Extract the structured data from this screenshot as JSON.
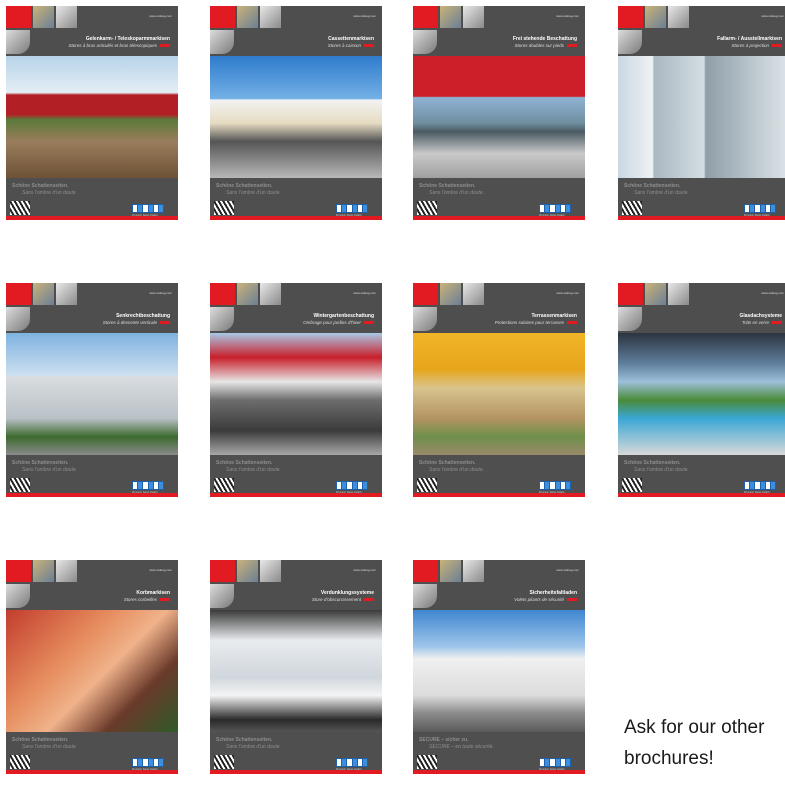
{
  "brochures": [
    {
      "url": "www.stobag.com",
      "title": "Gelenkarm- / Teleskoparmmarkisen",
      "subtitle": "Stores à bras articulés et bras télescopiques",
      "slogan1": "Schöne Schattenseiten.",
      "slogan2": "Sans l'ombre d'un doute."
    },
    {
      "url": "www.stobag.com",
      "title": "Cassettenmarkisen",
      "subtitle": "Stores à caisson",
      "slogan1": "Schöne Schattenseiten.",
      "slogan2": "Sans l'ombre d'un doute."
    },
    {
      "url": "www.stobag.com",
      "title": "Frei stehende Beschattung",
      "subtitle": "Stores doubles sur pieds",
      "slogan1": "Schöne Schattenseiten.",
      "slogan2": "Sans l'ombre d'un doute."
    },
    {
      "url": "www.stobag.com",
      "title": "Fallarm- / Ausstellmarkisen",
      "subtitle": "Stores à projection",
      "slogan1": "Schöne Schattenseiten.",
      "slogan2": "Sans l'ombre d'un doute."
    },
    {
      "url": "www.stobag.com",
      "title": "Senkrechtbeschattung",
      "subtitle": "Stores à descente verticale",
      "slogan1": "Schöne Schattenseiten.",
      "slogan2": "Sans l'ombre d'un doute."
    },
    {
      "url": "www.stobag.com",
      "title": "Wintergartenbeschattung",
      "subtitle": "Ombrage pour jardins d'hiver",
      "slogan1": "Schöne Schattenseiten.",
      "slogan2": "Sans l'ombre d'un doute."
    },
    {
      "url": "www.stobag.com",
      "title": "Terrassenmarkisen",
      "subtitle": "Protections solaires pour terrasses",
      "slogan1": "Schöne Schattenseiten.",
      "slogan2": "Sans l'ombre d'un doute."
    },
    {
      "url": "www.stobag.com",
      "title": "Glasdachsysteme",
      "subtitle": "Toits en verre",
      "slogan1": "Schöne Schattenseiten.",
      "slogan2": "Sans l'ombre d'un doute."
    },
    {
      "url": "www.stobag.com",
      "title": "Korbmarkisen",
      "subtitle": "Stores corbeilles",
      "slogan1": "Schöne Schattenseiten.",
      "slogan2": "Sans l'ombre d'un doute."
    },
    {
      "url": "www.stobag.com",
      "title": "Verdunklungssysteme",
      "subtitle": "Store d'obscurcissement",
      "slogan1": "Schöne Schattenseiten.",
      "slogan2": "Sans l'ombre d'un doute."
    },
    {
      "url": "www.stobag.com",
      "title": "Sicherheitsfaltladen",
      "subtitle": "Volets pliants de sécurité",
      "slogan1": "SECURE – sicher zu.",
      "slogan2": "SECURE – en toute sécurité."
    }
  ],
  "logo_subtext": "Premium Swiss Quality",
  "caption": "Ask for our other brochures!",
  "colors": {
    "accent_red": "#e21a22",
    "cover_gray": "#505050",
    "logo_blue": "#1f5faa"
  }
}
